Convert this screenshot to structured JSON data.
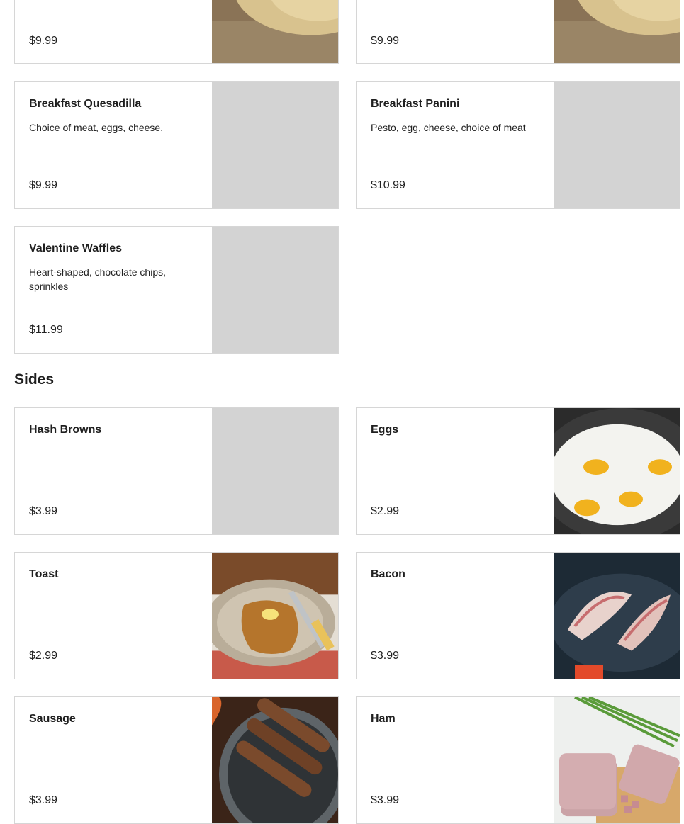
{
  "breakfast_items": [
    {
      "name": "",
      "description": "",
      "price": "$9.99",
      "image": "burrito-photo"
    },
    {
      "name": "",
      "description": "",
      "price": "$9.99",
      "image": "burrito-photo"
    },
    {
      "name": "Breakfast Quesadilla",
      "description": "Choice of meat, eggs, cheese.",
      "price": "$9.99",
      "image": "placeholder"
    },
    {
      "name": "Breakfast Panini",
      "description": "Pesto, egg, cheese, choice of meat",
      "price": "$10.99",
      "image": "placeholder"
    },
    {
      "name": "Valentine Waffles",
      "description": "Heart-shaped, chocolate chips, sprinkles",
      "price": "$11.99",
      "image": "placeholder"
    }
  ],
  "sides": {
    "title": "Sides",
    "items": [
      {
        "name": "Hash Browns",
        "price": "$3.99",
        "image": "placeholder"
      },
      {
        "name": "Eggs",
        "price": "$2.99",
        "image": "fried-eggs-photo"
      },
      {
        "name": "Toast",
        "price": "$2.99",
        "image": "toast-photo"
      },
      {
        "name": "Bacon",
        "price": "$3.99",
        "image": "bacon-photo"
      },
      {
        "name": "Sausage",
        "price": "$3.99",
        "image": "sausage-photo"
      },
      {
        "name": "Ham",
        "price": "$3.99",
        "image": "ham-photo"
      }
    ]
  }
}
